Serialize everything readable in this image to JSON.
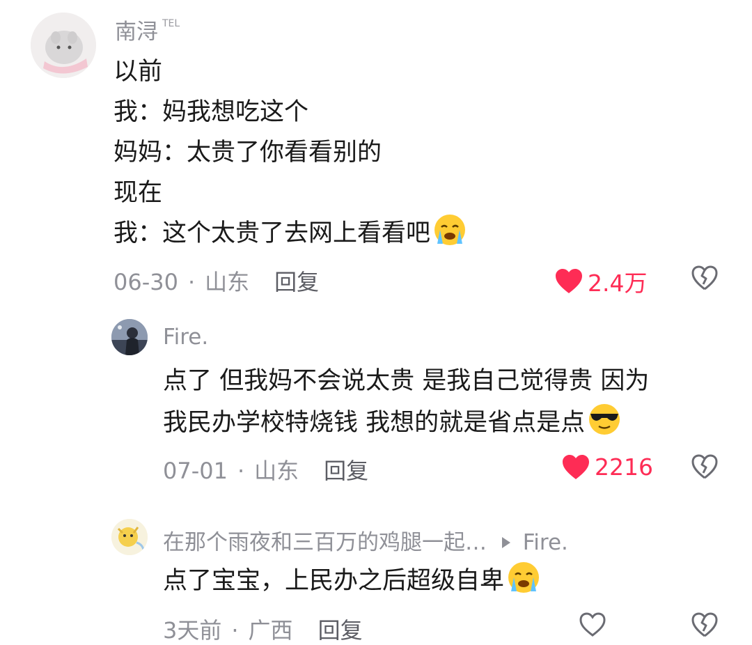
{
  "comment1": {
    "author": "南浔",
    "author_tag": "TEL",
    "lines": [
      "以前",
      "我：妈我想吃这个",
      "妈妈：太贵了你看看别的",
      "现在",
      "我：这个太贵了去网上看看吧"
    ],
    "emoji": "crying-face",
    "date": "06-30",
    "location": "山东",
    "reply_label": "回复",
    "likes": "2.4万"
  },
  "comment2": {
    "author": "Fire.",
    "lines": [
      "点了 但我妈不会说太贵 是我自己觉得贵 因为",
      "我民办学校特烧钱 我想的就是省点是点"
    ],
    "emoji": "sunglasses-face",
    "date": "07-01",
    "location": "山东",
    "reply_label": "回复",
    "likes": "2216"
  },
  "comment3": {
    "author": "在那个雨夜和三百万的鸡腿一起…",
    "reply_to": "Fire.",
    "lines": [
      "点了宝宝，上民办之后超级自卑"
    ],
    "emoji": "crying-face",
    "date": "3天前",
    "location": "广西",
    "reply_label": "回复"
  },
  "separator": "·",
  "colors": {
    "like": "#fe2c55",
    "meta": "#8f9097"
  }
}
